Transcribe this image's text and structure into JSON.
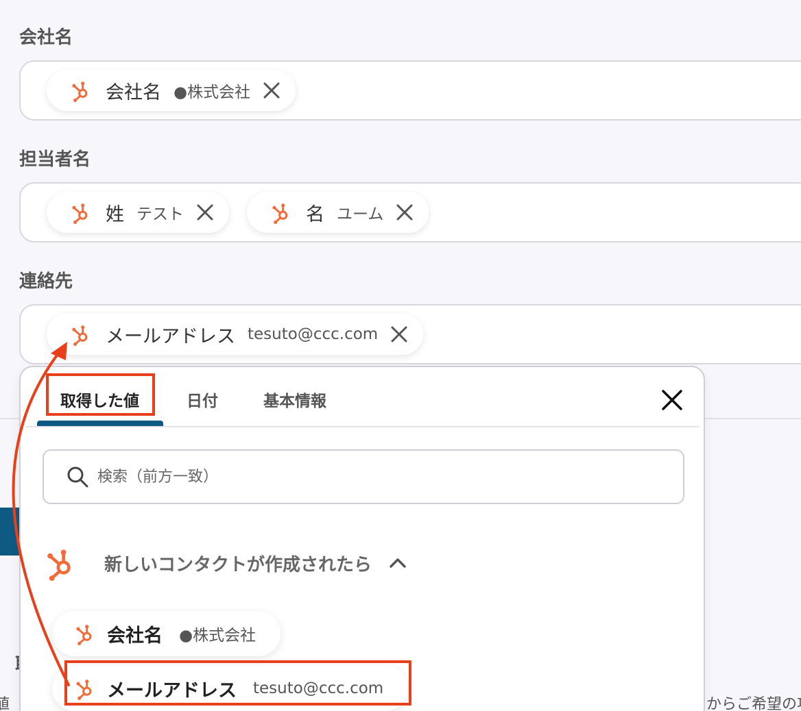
{
  "fields": [
    {
      "label": "会社名",
      "chips": [
        {
          "label": "会社名",
          "value": "●株式会社"
        }
      ]
    },
    {
      "label": "担当者名",
      "chips": [
        {
          "label": "姓",
          "value": "テスト"
        },
        {
          "label": "名",
          "value": "ユーム"
        }
      ]
    },
    {
      "label": "連絡先",
      "chips": [
        {
          "label": "メールアドレス",
          "value": "tesuto@ccc.com"
        }
      ]
    }
  ],
  "background": {
    "left_char": "取",
    "left_partial": "値",
    "right_partial": "からご希望の項"
  },
  "popup": {
    "tabs": [
      {
        "label": "取得した値"
      },
      {
        "label": "日付"
      },
      {
        "label": "基本情報"
      }
    ],
    "search": {
      "placeholder": "検索（前方一致）"
    },
    "section": {
      "title": "新しいコンタクトが作成されたら",
      "items": [
        {
          "label": "会社名",
          "value": "●株式会社"
        },
        {
          "label": "メールアドレス",
          "value": "tesuto@ccc.com"
        }
      ]
    }
  },
  "colors": {
    "hubspot": "#f26c3a",
    "accent": "#0e5a82",
    "highlight": "#e8401a"
  }
}
